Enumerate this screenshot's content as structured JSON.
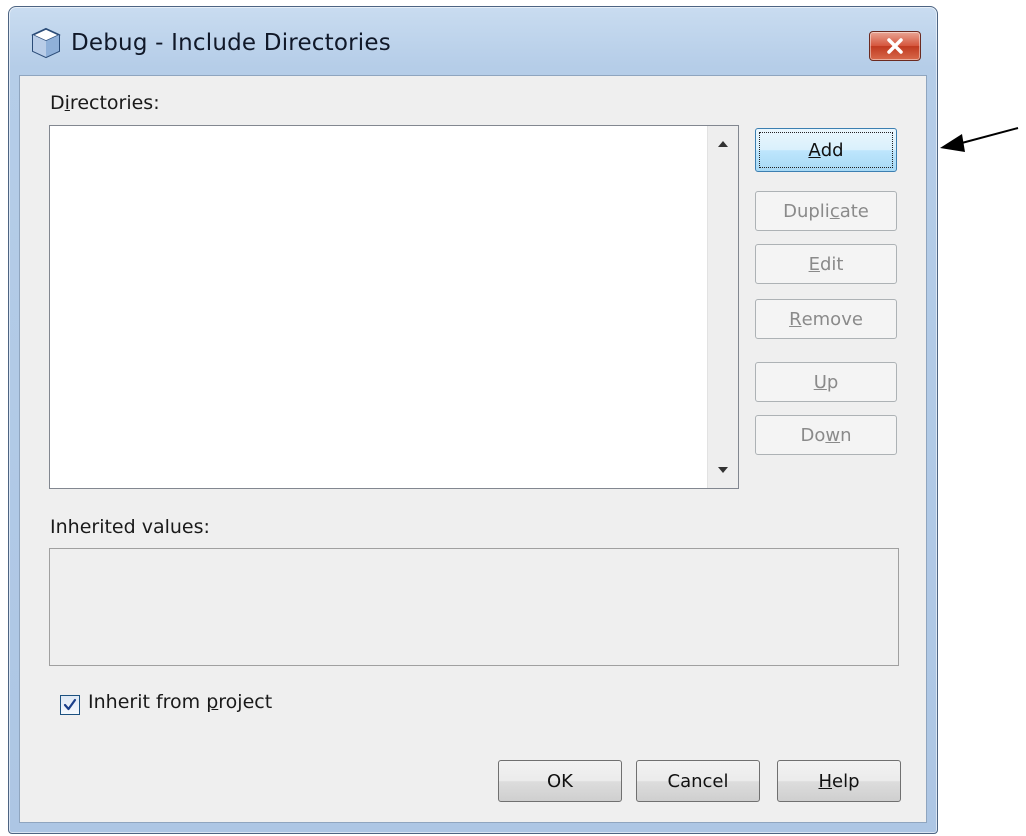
{
  "window": {
    "title": "Debug - Include Directories",
    "icons": {
      "app": "cube-icon",
      "close": "close-icon"
    }
  },
  "directories": {
    "label_pre": "D",
    "label_mnemonic": "i",
    "label_post": "rectories:",
    "items": []
  },
  "buttons": {
    "add": {
      "pre": "",
      "mnemonic": "A",
      "post": "dd",
      "enabled": true,
      "default": true
    },
    "duplicate": {
      "pre": "Dupli",
      "mnemonic": "c",
      "post": "ate",
      "enabled": false
    },
    "edit": {
      "pre": "",
      "mnemonic": "E",
      "post": "dit",
      "enabled": false
    },
    "remove": {
      "pre": "",
      "mnemonic": "R",
      "post": "emove",
      "enabled": false
    },
    "up": {
      "pre": "",
      "mnemonic": "U",
      "post": "p",
      "enabled": false
    },
    "down": {
      "pre": "Do",
      "mnemonic": "w",
      "post": "n",
      "enabled": false
    }
  },
  "inherited": {
    "label": "Inherited values:",
    "value": ""
  },
  "inherit_checkbox": {
    "checked": true,
    "label_pre": "Inherit from ",
    "label_mnemonic": "p",
    "label_post": "roject"
  },
  "footer": {
    "ok": "OK",
    "cancel": "Cancel",
    "help_mnemonic": "H",
    "help_post": "elp"
  },
  "annotation": {
    "icon": "arrow-left-icon",
    "color": "#000000"
  },
  "colors": {
    "title_bar": "#b5cde8",
    "default_button": "#bee6fd",
    "close_button": "#c03a20"
  }
}
